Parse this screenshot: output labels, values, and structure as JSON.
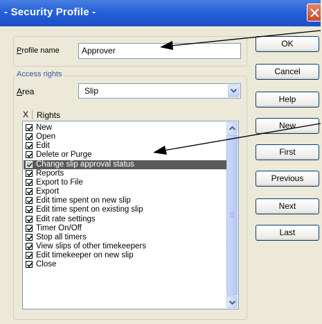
{
  "window": {
    "title": "- Security Profile -"
  },
  "profile": {
    "label": "Profile name",
    "label_prefix": "P",
    "label_rest": "rofile name",
    "value": "Approver"
  },
  "access_rights": {
    "group_label": "Access rights",
    "area_label_prefix": "A",
    "area_label_rest": "rea",
    "area_value": "Slip",
    "list_header_mark": "X",
    "list_header_label": "Rights",
    "items": [
      {
        "label": "New",
        "checked": true
      },
      {
        "label": "Open",
        "checked": true
      },
      {
        "label": "Edit",
        "checked": true
      },
      {
        "label": "Delete or Purge",
        "checked": true
      },
      {
        "label": "Change slip approval status",
        "checked": true,
        "selected": true
      },
      {
        "label": "Reports",
        "checked": true
      },
      {
        "label": "Export to File",
        "checked": true
      },
      {
        "label": "Export",
        "checked": true
      },
      {
        "label": "Edit time spent on new slip",
        "checked": true
      },
      {
        "label": "Edit time spent on existing slip",
        "checked": true
      },
      {
        "label": "Edit rate settings",
        "checked": true
      },
      {
        "label": "Timer On/Off",
        "checked": true
      },
      {
        "label": "Stop all timers",
        "checked": true
      },
      {
        "label": "View slips of other timekeepers",
        "checked": true
      },
      {
        "label": "Edit timekeeper on new slip",
        "checked": true
      },
      {
        "label": "Close",
        "checked": true
      }
    ]
  },
  "buttons": {
    "ok": "OK",
    "cancel": "Cancel",
    "help": "Help",
    "new": "New",
    "first": "First",
    "previous": "Previous",
    "next": "Next",
    "last": "Last"
  }
}
